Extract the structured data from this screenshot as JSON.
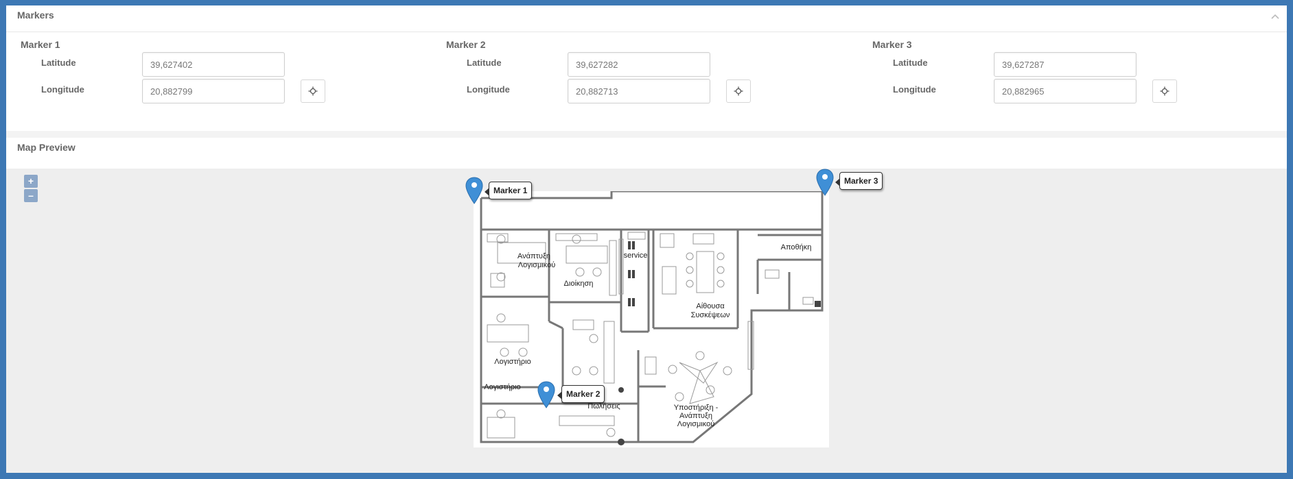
{
  "markers_panel": {
    "title": "Markers",
    "collapse_icon": "chevron-up-icon"
  },
  "markers": [
    {
      "title": "Marker 1",
      "latitude_label": "Latitude",
      "latitude": "39,627402",
      "longitude_label": "Longitude",
      "longitude": "20,882799",
      "locate_icon": "crosshair-icon"
    },
    {
      "title": "Marker 2",
      "latitude_label": "Latitude",
      "latitude": "39,627282",
      "longitude_label": "Longitude",
      "longitude": "20,882713",
      "locate_icon": "crosshair-icon"
    },
    {
      "title": "Marker 3",
      "latitude_label": "Latitude",
      "latitude": "39,627287",
      "longitude_label": "Longitude",
      "longitude": "20,882965",
      "locate_icon": "crosshair-icon"
    }
  ],
  "map_panel": {
    "title": "Map Preview",
    "zoom_in": "+",
    "zoom_out": "–",
    "pins": [
      {
        "label": "Marker 1"
      },
      {
        "label": "Marker 2"
      },
      {
        "label": "Marker 3"
      }
    ],
    "rooms": {
      "dev": [
        "Ανάπτυξη",
        "Λογισμικού"
      ],
      "admin": "Διοίκηση",
      "service": "service",
      "storage": "Αποθήκη",
      "meeting": [
        "Αίθουσα",
        "Συσκέψεων"
      ],
      "accounting1": "Λογιστήριο",
      "accounting2": "Λογιστήριο",
      "sales": "Πωλήσεις",
      "support": [
        "Υποστήριξη -",
        "Ανάπτυξη",
        "Λογισμικού"
      ]
    }
  },
  "colors": {
    "frame": "#3d78b4",
    "pin": "#3f8fd6",
    "wall": "#777777"
  }
}
